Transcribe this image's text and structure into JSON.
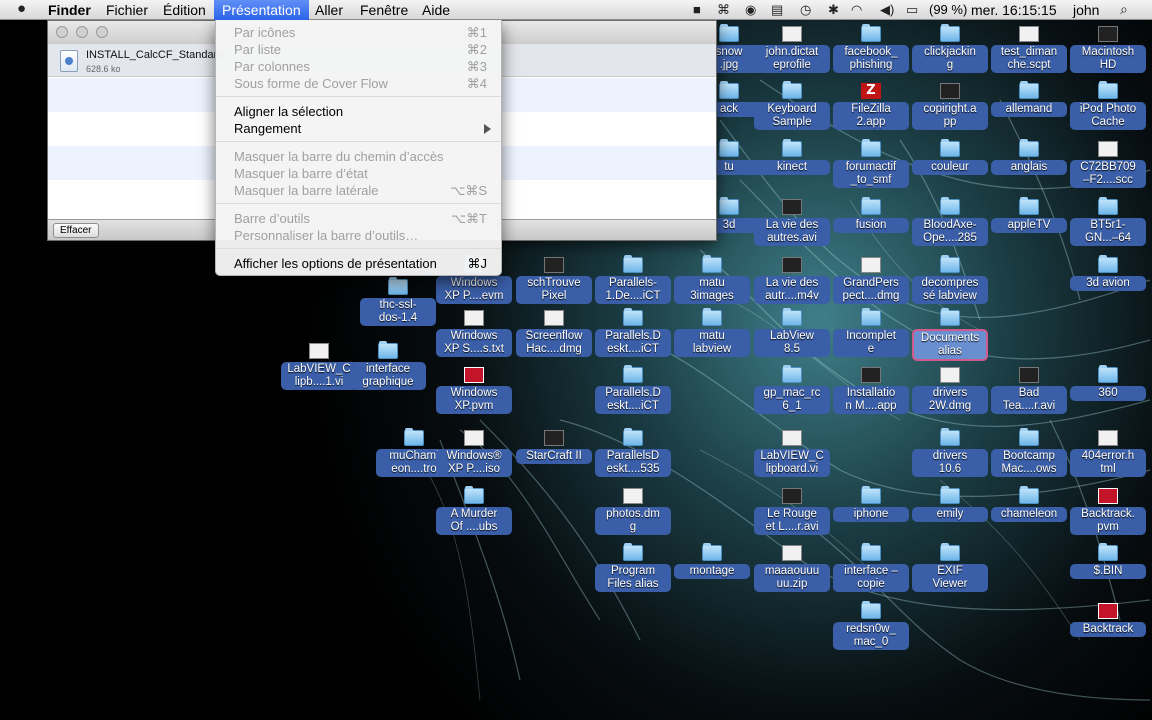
{
  "menubar": {
    "apple": "",
    "items": [
      "Finder",
      "Fichier",
      "Édition",
      "Présentation",
      "Aller",
      "Fenêtre",
      "Aide"
    ],
    "battery": "(99 %)",
    "clock": "mer. 16:15:15",
    "user": "john"
  },
  "finder_window": {
    "file_name": "INSTALL_CalcCF_Standard.",
    "file_size": "628.6 ko",
    "clear_button": "Effacer"
  },
  "menu": {
    "items": [
      {
        "label": "Par icônes",
        "shortcut": "⌘1",
        "enabled": false
      },
      {
        "label": "Par liste",
        "shortcut": "⌘2",
        "enabled": false
      },
      {
        "label": "Par colonnes",
        "shortcut": "⌘3",
        "enabled": false
      },
      {
        "label": "Sous forme de Cover Flow",
        "shortcut": "⌘4",
        "enabled": false
      },
      {
        "label": "Aligner la sélection",
        "shortcut": "",
        "enabled": true
      },
      {
        "label": "Rangement",
        "shortcut": "",
        "enabled": true
      },
      {
        "label": "Masquer la barre du chemin d’accès",
        "shortcut": "",
        "enabled": false
      },
      {
        "label": "Masquer la barre d’état",
        "shortcut": "",
        "enabled": false
      },
      {
        "label": "Masquer la barre latérale",
        "shortcut": "⌥⌘S",
        "enabled": false
      },
      {
        "label": "Barre d’outils",
        "shortcut": "⌥⌘T",
        "enabled": false
      },
      {
        "label": "Personnaliser la barre d’outils…",
        "shortcut": "",
        "enabled": false
      },
      {
        "label": "Afficher les options de présentation",
        "shortcut": "⌘J",
        "enabled": true
      }
    ]
  },
  "desktop_icons": [
    {
      "label": "snow\n.jpg",
      "icon": "folder-icon"
    },
    {
      "label": "john.dictat\neprofile",
      "icon": "document-icon"
    },
    {
      "label": "facebook_\nphishing",
      "icon": "folder-icon"
    },
    {
      "label": "clickjackin\ng",
      "icon": "folder-icon"
    },
    {
      "label": "test_diman\nche.scpt",
      "icon": "script-icon"
    },
    {
      "label": "Macintosh\nHD",
      "icon": "disk-icon"
    },
    {
      "label": "ack",
      "icon": "folder-icon"
    },
    {
      "label": "Keyboard\nSample",
      "icon": "folder-icon"
    },
    {
      "label": "FileZilla\n2.app",
      "icon": "filezilla-icon"
    },
    {
      "label": "copiright.a\npp",
      "icon": "app-icon"
    },
    {
      "label": "allemand",
      "icon": "folder-icon"
    },
    {
      "label": "iPod Photo\nCache",
      "icon": "folder-icon"
    },
    {
      "label": "tu",
      "icon": "folder-icon"
    },
    {
      "label": "kinect",
      "icon": "folder-icon"
    },
    {
      "label": "forumactif\n_to_smf",
      "icon": "folder-icon"
    },
    {
      "label": "couleur",
      "icon": "folder-icon"
    },
    {
      "label": "anglais",
      "icon": "folder-icon"
    },
    {
      "label": "C72BB709\n–F2....scc",
      "icon": "document-icon"
    },
    {
      "label": "3d",
      "icon": "folder-icon"
    },
    {
      "label": "La vie des\nautres.avi",
      "icon": "video-icon"
    },
    {
      "label": "fusion",
      "icon": "folder-icon"
    },
    {
      "label": "BloodAxe-\nOpe....285",
      "icon": "folder-icon"
    },
    {
      "label": "appleTV",
      "icon": "folder-icon"
    },
    {
      "label": "BT5r1-\nGN...–64",
      "icon": "folder-icon"
    },
    {
      "label": "Windows\nXP P....evm",
      "icon": "folder-icon"
    },
    {
      "label": "schTrouve\nPixel",
      "icon": "image-icon"
    },
    {
      "label": "Parallels-\n1.De....iCT",
      "icon": "folder-icon"
    },
    {
      "label": "matu\n3images",
      "icon": "folder-icon"
    },
    {
      "label": "La vie des\nautr....m4v",
      "icon": "video-icon"
    },
    {
      "label": "GrandPers\npect....dmg",
      "icon": "document-icon"
    },
    {
      "label": "decompres\nsé labview",
      "icon": "folder-icon"
    },
    {
      "label": "3d avion",
      "icon": "folder-icon"
    },
    {
      "label": "thc-ssl-\ndos-1.4",
      "icon": "folder-icon"
    },
    {
      "label": "Windows\nXP S....s.txt",
      "icon": "text-icon"
    },
    {
      "label": "Screenflow\nHac....dmg",
      "icon": "document-icon"
    },
    {
      "label": "Parallels.D\neskt....iCT",
      "icon": "folder-icon"
    },
    {
      "label": "matu\nlabview",
      "icon": "folder-icon"
    },
    {
      "label": "LabView\n8.5",
      "icon": "folder-icon"
    },
    {
      "label": "Incomplet\ne",
      "icon": "folder-icon"
    },
    {
      "label": "Documents\nalias",
      "icon": "folder-icon"
    },
    {
      "label": "LabVIEW_C\nlipb....1.vi",
      "icon": "vi-icon"
    },
    {
      "label": "interface\ngraphique",
      "icon": "folder-icon"
    },
    {
      "label": "Windows\nXP.pvm",
      "icon": "parallels-icon"
    },
    {
      "label": "Parallels.D\neskt....iCT",
      "icon": "folder-icon"
    },
    {
      "label": "gp_mac_rc\n6_1",
      "icon": "folder-icon"
    },
    {
      "label": "Installatio\nn M....app",
      "icon": "app-icon"
    },
    {
      "label": "drivers\n2W.dmg",
      "icon": "document-icon"
    },
    {
      "label": "Bad\nTea....r.avi",
      "icon": "video-icon"
    },
    {
      "label": "360",
      "icon": "folder-icon"
    },
    {
      "label": "muChami\neon....tro",
      "icon": "folder-icon"
    },
    {
      "label": "Windows®\nXP P....iso",
      "icon": "document-icon"
    },
    {
      "label": "StarCraft II",
      "icon": "app-icon"
    },
    {
      "label": "ParallelsD\neskt....535",
      "icon": "folder-icon"
    },
    {
      "label": "LabVIEW_C\nlipboard.vi",
      "icon": "vi-icon"
    },
    {
      "label": "drivers\n10.6",
      "icon": "folder-icon"
    },
    {
      "label": "Bootcamp\nMac....ows",
      "icon": "folder-icon"
    },
    {
      "label": "404error.h\ntml",
      "icon": "document-icon"
    },
    {
      "label": "A Murder\nOf ....ubs",
      "icon": "folder-icon"
    },
    {
      "label": "photos.dm\ng",
      "icon": "document-icon"
    },
    {
      "label": "Le Rouge\net L....r.avi",
      "icon": "video-icon"
    },
    {
      "label": "iphone",
      "icon": "folder-icon"
    },
    {
      "label": "emily",
      "icon": "folder-icon"
    },
    {
      "label": "chameleon",
      "icon": "folder-icon"
    },
    {
      "label": "Backtrack.\npvm",
      "icon": "parallels-icon"
    },
    {
      "label": "Program\nFiles alias",
      "icon": "folder-icon"
    },
    {
      "label": "montage",
      "icon": "folder-icon"
    },
    {
      "label": "maaaouuu\nuu.zip",
      "icon": "zip-icon"
    },
    {
      "label": "interface –\ncopie",
      "icon": "folder-icon"
    },
    {
      "label": "EXIF\nViewer",
      "icon": "folder-icon"
    },
    {
      "label": "$.BIN",
      "icon": "folder-icon"
    },
    {
      "label": "redsn0w_\nmac_0",
      "icon": "folder-icon"
    },
    {
      "label": "Backtrack",
      "icon": "parallels-icon"
    }
  ]
}
